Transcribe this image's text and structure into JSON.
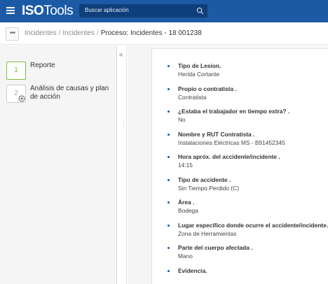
{
  "header": {
    "menu_icon": "hamburger-icon",
    "logo_iso": "ISO",
    "logo_tools": "Tools",
    "search_placeholder": "Buscar aplicación",
    "search_icon": "search-icon",
    "brand_color": "#1c5aa6"
  },
  "breadcrumb": {
    "more_label": "•••",
    "items": [
      "Incidentes",
      "Incidentes"
    ],
    "current": "Proceso: Incidentes - 18 001238"
  },
  "steps": [
    {
      "number": "1",
      "label": "Reporte",
      "state": "active",
      "color": "#7dbb42"
    },
    {
      "number": "2",
      "label": "Análisis de causas y plan de acción",
      "state": "inactive",
      "icon": "plus-circle-icon"
    }
  ],
  "splitter": {
    "collapse_label": "«",
    "grip_label": "⋮"
  },
  "fields": [
    {
      "label": "Tipo de Lesion.",
      "value": "Herida Cortante"
    },
    {
      "label": "Propio o contratista .",
      "value": "Contratista"
    },
    {
      "label": "¿Estaba el trabajador en tiempo extra? .",
      "value": "No"
    },
    {
      "label": "Nombre y RUT Contratista .",
      "value": "Instalaciones Eléctricas MS - B91452345"
    },
    {
      "label": "Hora apróx. del accidente/incidente .",
      "value": "14:15"
    },
    {
      "label": "Tipo de accidente .",
      "value": "Sin Tiempo Perdido (C)"
    },
    {
      "label": "Área .",
      "value": "Bodega"
    },
    {
      "label": "Lugar específico donde ocurre el accidente/incidente.",
      "value": "Zona de Herramientas"
    },
    {
      "label": "Parte del cuerpo afectada .",
      "value": "Mano"
    },
    {
      "label": "Evidencia.",
      "value": ""
    }
  ]
}
